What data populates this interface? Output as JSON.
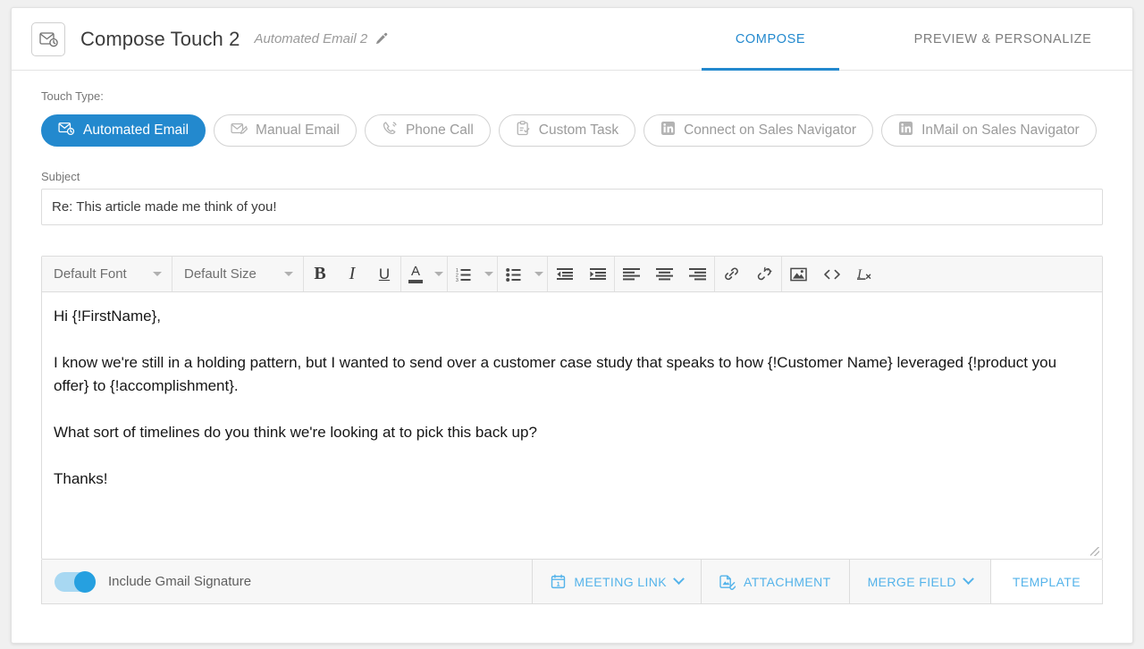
{
  "header": {
    "icon": "email-clock-icon",
    "title": "Compose Touch 2",
    "subtitle": "Automated Email 2",
    "edit_icon": "pencil-icon",
    "tabs": [
      {
        "label": "COMPOSE",
        "active": true
      },
      {
        "label": "PREVIEW & PERSONALIZE",
        "active": false
      }
    ]
  },
  "touch_type": {
    "label": "Touch Type:",
    "options": [
      {
        "label": "Automated Email",
        "icon": "email-clock-icon",
        "selected": true
      },
      {
        "label": "Manual Email",
        "icon": "email-pencil-icon",
        "selected": false
      },
      {
        "label": "Phone Call",
        "icon": "phone-icon",
        "selected": false
      },
      {
        "label": "Custom Task",
        "icon": "clipboard-check-icon",
        "selected": false
      },
      {
        "label": "Connect on Sales Navigator",
        "icon": "linkedin-icon",
        "selected": false
      },
      {
        "label": "InMail on Sales Navigator",
        "icon": "linkedin-icon",
        "selected": false
      }
    ]
  },
  "subject": {
    "label": "Subject",
    "value": "Re: This article made me think of you!",
    "placeholder": "Subject"
  },
  "editor": {
    "toolbar": {
      "font_select": "Default Font",
      "size_select": "Default Size",
      "bold": "B",
      "italic": "I",
      "underline": "U",
      "font_color": "A",
      "numbered_list": "numbered-list-icon",
      "bulleted_list": "bulleted-list-icon",
      "outdent": "outdent-icon",
      "indent": "indent-icon",
      "align_left": "align-left-icon",
      "align_center": "align-center-icon",
      "align_right": "align-right-icon",
      "insert_link": "link-icon",
      "remove_link": "unlink-icon",
      "insert_image": "image-icon",
      "source_code": "<>",
      "clear_formatting": "clear-formatting-icon"
    },
    "body": [
      "Hi {!FirstName},",
      "I know we're still in a holding pattern, but I wanted to send over a customer case study that speaks to how {!Customer Name} leveraged {!product you offer} to {!accomplishment}.",
      "What sort of timelines do you think we're looking at to pick this back up?",
      "Thanks!"
    ]
  },
  "footer": {
    "signature_toggle": {
      "label": "Include Gmail Signature",
      "on": true
    },
    "buttons": [
      {
        "label": "MEETING LINK",
        "icon": "calendar-icon",
        "caret": true
      },
      {
        "label": "ATTACHMENT",
        "icon": "attachment-icon",
        "caret": false
      },
      {
        "label": "MERGE FIELD",
        "icon": null,
        "caret": true
      },
      {
        "label": "TEMPLATE",
        "icon": null,
        "caret": false
      }
    ]
  },
  "colors": {
    "accent": "#2389ce",
    "footer_link": "#54b3ea",
    "toggle_on": "#26a0e0",
    "muted_text": "#9b9b9b"
  }
}
